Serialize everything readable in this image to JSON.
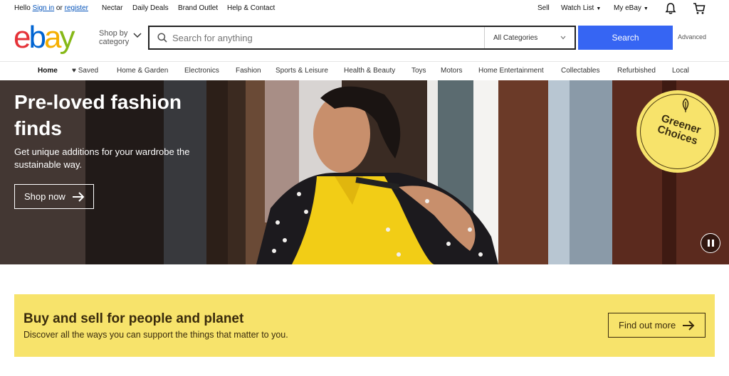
{
  "topbar": {
    "hello": "Hello",
    "sign_in": "Sign in",
    "or": " or ",
    "register": "register",
    "links": [
      "Nectar",
      "Daily Deals",
      "Brand Outlet",
      "Help & Contact"
    ],
    "sell": "Sell",
    "watch_list": "Watch List",
    "my_ebay": "My eBay"
  },
  "header": {
    "logo_letters": [
      "e",
      "b",
      "a",
      "y"
    ],
    "logo_colors": [
      "#e53238",
      "#0064d2",
      "#f5af02",
      "#86b817"
    ],
    "shop_by_line1": "Shop by",
    "shop_by_line2": "category",
    "search_placeholder": "Search for anything",
    "search_value": "",
    "category_selected": "All Categories",
    "search_button": "Search",
    "advanced": "Advanced"
  },
  "nav": {
    "items": [
      "Home",
      "Saved",
      "Home & Garden",
      "Electronics",
      "Fashion",
      "Sports & Leisure",
      "Health & Beauty",
      "Toys",
      "Motors",
      "Home Entertainment",
      "Collectables",
      "Refurbished",
      "Local"
    ]
  },
  "hero": {
    "title": "Pre-loved fashion finds",
    "subtitle": "Get unique additions for your wardrobe the sustainable way.",
    "button": "Shop now",
    "badge": "Greener Choices"
  },
  "promo": {
    "title": "Buy and sell for people and planet",
    "subtitle": "Discover all the ways you can support the things that matter to you.",
    "button": "Find out more"
  },
  "colors": {
    "accent_blue": "#3665f3",
    "link_blue": "#0654ba",
    "promo_yellow": "#f7e36b"
  }
}
